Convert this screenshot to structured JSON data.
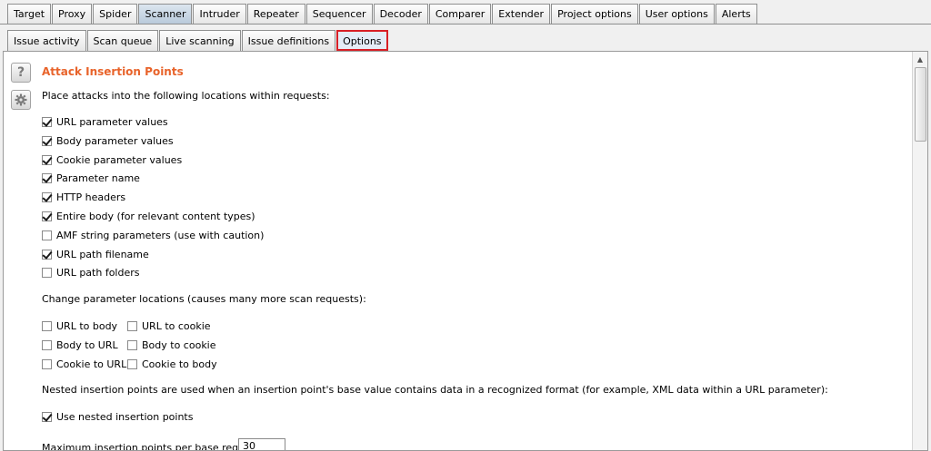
{
  "main_tabs": [
    {
      "label": "Target"
    },
    {
      "label": "Proxy"
    },
    {
      "label": "Spider"
    },
    {
      "label": "Scanner",
      "active": true
    },
    {
      "label": "Intruder"
    },
    {
      "label": "Repeater"
    },
    {
      "label": "Sequencer"
    },
    {
      "label": "Decoder"
    },
    {
      "label": "Comparer"
    },
    {
      "label": "Extender"
    },
    {
      "label": "Project options"
    },
    {
      "label": "User options"
    },
    {
      "label": "Alerts"
    }
  ],
  "sub_tabs": [
    {
      "label": "Issue activity"
    },
    {
      "label": "Scan queue"
    },
    {
      "label": "Live scanning"
    },
    {
      "label": "Issue definitions"
    },
    {
      "label": "Options",
      "active": true
    }
  ],
  "section": {
    "title": "Attack Insertion Points",
    "intro": "Place attacks into the following locations within requests:",
    "locations": [
      {
        "label": "URL parameter values",
        "checked": true
      },
      {
        "label": "Body parameter values",
        "checked": true
      },
      {
        "label": "Cookie parameter values",
        "checked": true
      },
      {
        "label": "Parameter name",
        "checked": true
      },
      {
        "label": "HTTP headers",
        "checked": true
      },
      {
        "label": "Entire body (for relevant content types)",
        "checked": true
      },
      {
        "label": "AMF string parameters (use with caution)",
        "checked": false
      },
      {
        "label": "URL path filename",
        "checked": true
      },
      {
        "label": "URL path folders",
        "checked": false
      }
    ],
    "change_label": "Change parameter locations (causes many more scan requests):",
    "change_options": [
      {
        "label": "URL to body",
        "checked": false
      },
      {
        "label": "URL to cookie",
        "checked": false
      },
      {
        "label": "Body to URL",
        "checked": false
      },
      {
        "label": "Body to cookie",
        "checked": false
      },
      {
        "label": "Cookie to URL",
        "checked": false
      },
      {
        "label": "Cookie to body",
        "checked": false
      }
    ],
    "nested_label": "Nested insertion points are used when an insertion point's base value contains data in a recognized format (for example, XML data within a URL parameter):",
    "nested_option": {
      "label": "Use nested insertion points",
      "checked": true
    },
    "max_label": "Maximum insertion points per base request:",
    "max_value": "30"
  },
  "icons": {
    "help": "help-icon",
    "settings": "gear-icon"
  }
}
